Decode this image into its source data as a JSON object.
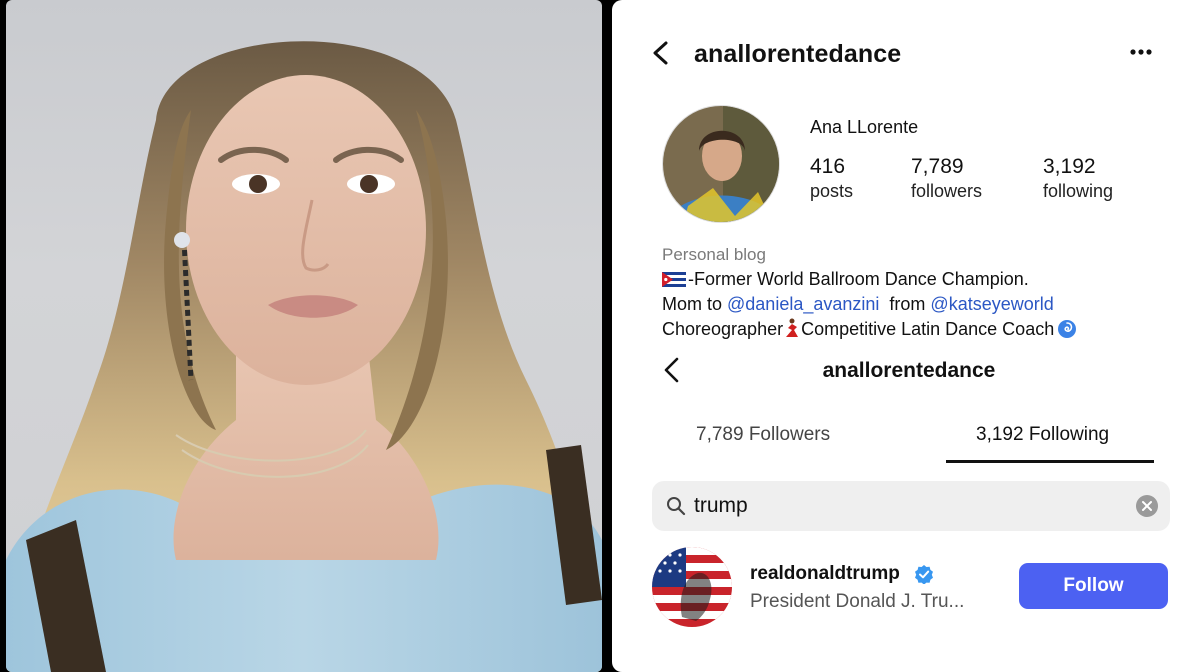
{
  "photo": {
    "icon": "portrait-photo"
  },
  "profile": {
    "username": "anallorentedance",
    "display_name": "Ana LLorente",
    "stats": {
      "posts_count": "416",
      "posts_label": "posts",
      "followers_count": "7,789",
      "followers_label": "followers",
      "following_count": "3,192",
      "following_label": "following"
    },
    "bio": {
      "category": "Personal blog",
      "line1": "-Former World Ballroom Dance Champion.",
      "line2_prefix": "Mom to ",
      "mention1": "@daniela_avanzini",
      "line2_mid": "  from ",
      "mention2": "@katseyeworld",
      "line3_a": "Choreographer",
      "line3_b": "Competitive Latin Dance Coach"
    }
  },
  "follow_list": {
    "title": "anallorentedance",
    "tabs": [
      {
        "label": "7,789 Followers"
      },
      {
        "label": "3,192 Following"
      }
    ],
    "search": {
      "value": "trump"
    },
    "results": [
      {
        "username": "realdonaldtrump",
        "full_name": "President Donald J. Tru...",
        "button_label": "Follow"
      }
    ]
  },
  "colors": {
    "accent_button": "#4c61f2",
    "mention_link": "#2b57c4",
    "verified_badge": "#3897f0"
  }
}
